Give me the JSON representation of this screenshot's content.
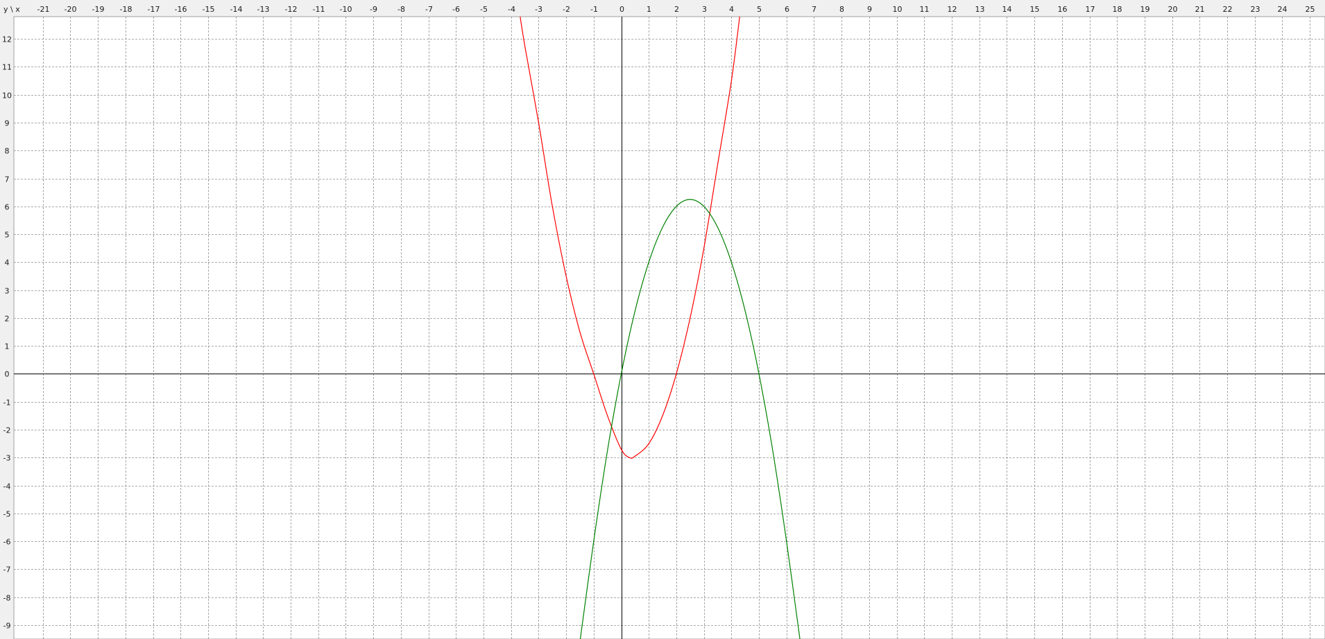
{
  "corner_label": "y \\ x",
  "colors": {
    "background": "#f0f0f0",
    "plot_background": "#ffffff",
    "grid": "#8f8f8f",
    "axis": "#000000",
    "series_red": "#ff0000",
    "series_green": "#008000"
  },
  "chart_data": {
    "type": "line",
    "title": "",
    "xlabel": "x",
    "ylabel": "y",
    "xlim": [
      -22.05,
      25.55
    ],
    "ylim": [
      -9.5,
      12.8
    ],
    "grid": true,
    "grid_style": "dashed",
    "x_ticks": [
      -21,
      -20,
      -19,
      -18,
      -17,
      -16,
      -15,
      -14,
      -13,
      -12,
      -11,
      -10,
      -9,
      -8,
      -7,
      -6,
      -5,
      -4,
      -3,
      -2,
      -1,
      0,
      1,
      2,
      3,
      4,
      5,
      6,
      7,
      8,
      9,
      10,
      11,
      12,
      13,
      14,
      15,
      16,
      17,
      18,
      19,
      20,
      21,
      22,
      23,
      24,
      25
    ],
    "y_ticks": [
      12,
      11,
      10,
      9,
      8,
      7,
      6,
      5,
      4,
      3,
      2,
      1,
      0,
      -1,
      -2,
      -3,
      -4,
      -5,
      -6,
      -7,
      -8,
      -9
    ],
    "series": [
      {
        "color": "#ff0000",
        "points": [
          [
            -3.7,
            13.0
          ],
          [
            -3.5,
            11.75
          ],
          [
            -3.0,
            9.0
          ],
          [
            -2.5,
            6.0
          ],
          [
            -2.0,
            3.5
          ],
          [
            -1.5,
            1.5
          ],
          [
            -1.0,
            0.0
          ],
          [
            -0.5,
            -1.5
          ],
          [
            0.0,
            -2.7
          ],
          [
            0.3,
            -3.0
          ],
          [
            0.5,
            -2.95
          ],
          [
            1.0,
            -2.5
          ],
          [
            1.5,
            -1.5
          ],
          [
            2.0,
            0.0
          ],
          [
            2.5,
            2.0
          ],
          [
            3.0,
            4.5
          ],
          [
            3.5,
            7.5
          ],
          [
            4.0,
            10.5
          ],
          [
            4.3,
            12.8
          ]
        ]
      },
      {
        "color": "#008000",
        "points": [
          [
            -1.5,
            -9.6
          ],
          [
            -1.0,
            -6.0
          ],
          [
            -0.5,
            -2.75
          ],
          [
            0.0,
            0.0
          ],
          [
            0.5,
            2.25
          ],
          [
            1.0,
            4.0
          ],
          [
            1.5,
            5.25
          ],
          [
            2.0,
            6.0
          ],
          [
            2.5,
            6.25
          ],
          [
            3.0,
            6.0
          ],
          [
            3.5,
            5.25
          ],
          [
            4.0,
            4.0
          ],
          [
            4.5,
            2.25
          ],
          [
            5.0,
            0.0
          ],
          [
            5.5,
            -2.75
          ],
          [
            6.0,
            -6.0
          ],
          [
            6.5,
            -9.6
          ]
        ]
      }
    ]
  }
}
